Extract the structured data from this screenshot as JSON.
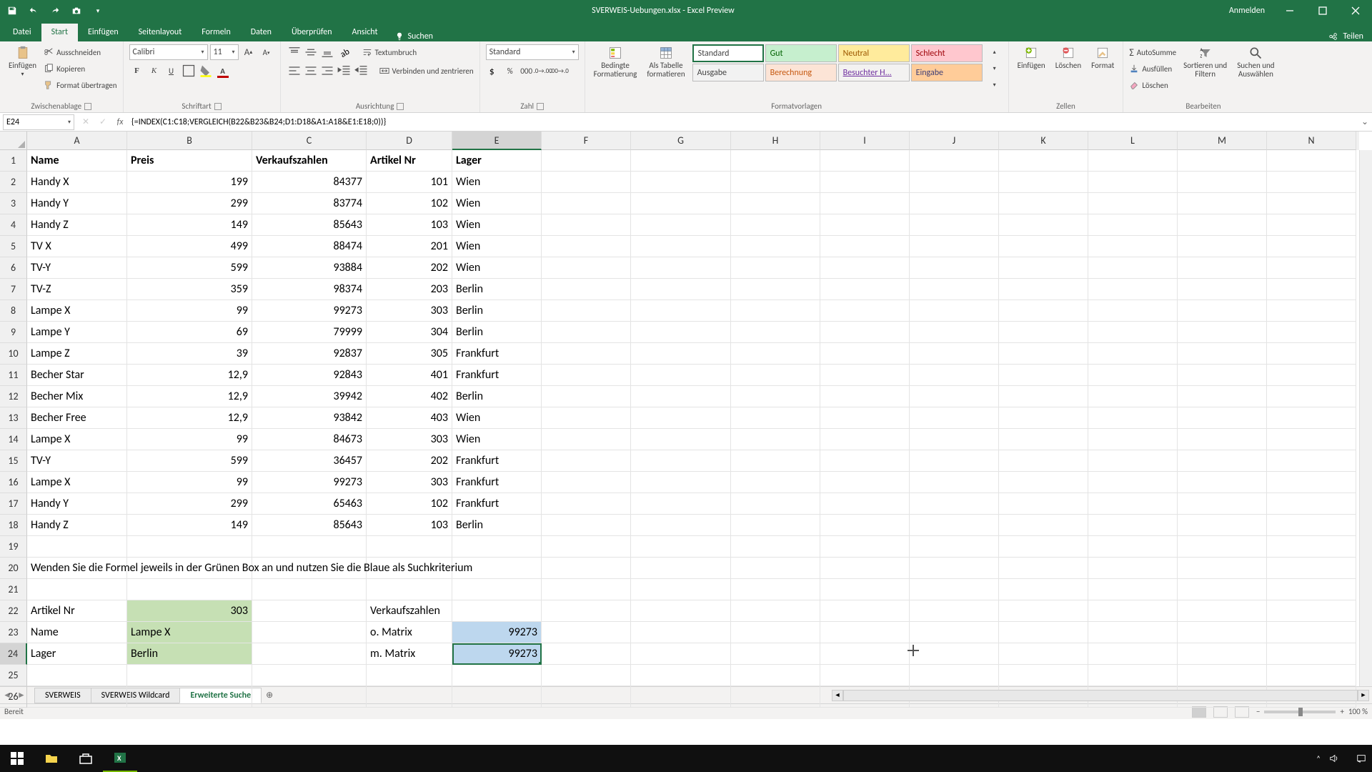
{
  "title": "SVERWEIS-Uebungen.xlsx - Excel Preview",
  "anmelden": "Anmelden",
  "tabs": {
    "datei": "Datei",
    "start": "Start",
    "einfuegen": "Einfügen",
    "seitenlayout": "Seitenlayout",
    "formeln": "Formeln",
    "daten": "Daten",
    "ueberpruefen": "Überprüfen",
    "ansicht": "Ansicht",
    "suchen": "Suchen",
    "teilen": "Teilen"
  },
  "ribbon": {
    "paste": "Einfügen",
    "cut": "Ausschneiden",
    "copy": "Kopieren",
    "formatpainter": "Format übertragen",
    "clipboard_label": "Zwischenablage",
    "font_name": "Calibri",
    "font_size": "11",
    "font_label": "Schriftart",
    "wrap": "Textumbruch",
    "merge": "Verbinden und zentrieren",
    "align_label": "Ausrichtung",
    "numfmt": "Standard",
    "num_label": "Zahl",
    "condfmt": "Bedingte\nFormatierung",
    "astable": "Als Tabelle\nformatieren",
    "style_standard": "Standard",
    "style_gut": "Gut",
    "style_neutral": "Neutral",
    "style_schlecht": "Schlecht",
    "style_ausgabe": "Ausgabe",
    "style_berechnung": "Berechnung",
    "style_besucht": "Besuchter H...",
    "style_eingabe": "Eingabe",
    "styles_label": "Formatvorlagen",
    "insert": "Einfügen",
    "delete": "Löschen",
    "format": "Format",
    "cells_label": "Zellen",
    "autosum": "AutoSumme",
    "fill": "Ausfüllen",
    "clear": "Löschen",
    "sort": "Sortieren und\nFiltern",
    "find": "Suchen und\nAuswählen",
    "edit_label": "Bearbeiten"
  },
  "namebox": "E24",
  "formula": "{=INDEX(C1:C18;VERGLEICH(B22&B23&B24;D1:D18&A1:A18&E1:E18;0))}",
  "cols": [
    "A",
    "B",
    "C",
    "D",
    "E",
    "F",
    "G",
    "H",
    "I",
    "J",
    "K",
    "L",
    "M",
    "N"
  ],
  "rows": [
    "1",
    "2",
    "3",
    "4",
    "5",
    "6",
    "7",
    "8",
    "9",
    "10",
    "11",
    "12",
    "13",
    "14",
    "15",
    "16",
    "17",
    "18",
    "19",
    "20",
    "21",
    "22",
    "23",
    "24",
    "25",
    "26"
  ],
  "grid": {
    "r1": {
      "A": "Name",
      "B": "Preis",
      "C": "Verkaufszahlen",
      "D": "Artikel Nr",
      "E": "Lager"
    },
    "r2": {
      "A": "Handy X",
      "B": "199",
      "C": "84377",
      "D": "101",
      "E": "Wien"
    },
    "r3": {
      "A": "Handy Y",
      "B": "299",
      "C": "83774",
      "D": "102",
      "E": "Wien"
    },
    "r4": {
      "A": "Handy Z",
      "B": "149",
      "C": "85643",
      "D": "103",
      "E": "Wien"
    },
    "r5": {
      "A": "TV X",
      "B": "499",
      "C": "88474",
      "D": "201",
      "E": "Wien"
    },
    "r6": {
      "A": "TV-Y",
      "B": "599",
      "C": "93884",
      "D": "202",
      "E": "Wien"
    },
    "r7": {
      "A": "TV-Z",
      "B": "359",
      "C": "98374",
      "D": "203",
      "E": "Berlin"
    },
    "r8": {
      "A": "Lampe X",
      "B": "99",
      "C": "99273",
      "D": "303",
      "E": "Berlin"
    },
    "r9": {
      "A": "Lampe Y",
      "B": "69",
      "C": "79999",
      "D": "304",
      "E": "Berlin"
    },
    "r10": {
      "A": "Lampe Z",
      "B": "39",
      "C": "92837",
      "D": "305",
      "E": "Frankfurt"
    },
    "r11": {
      "A": "Becher Star",
      "B": "12,9",
      "C": "92843",
      "D": "401",
      "E": "Frankfurt"
    },
    "r12": {
      "A": "Becher Mix",
      "B": "12,9",
      "C": "39942",
      "D": "402",
      "E": "Berlin"
    },
    "r13": {
      "A": "Becher Free",
      "B": "12,9",
      "C": "93842",
      "D": "403",
      "E": "Wien"
    },
    "r14": {
      "A": "Lampe X",
      "B": "99",
      "C": "84673",
      "D": "303",
      "E": "Wien"
    },
    "r15": {
      "A": "TV-Y",
      "B": "599",
      "C": "36457",
      "D": "202",
      "E": "Frankfurt"
    },
    "r16": {
      "A": "Lampe X",
      "B": "99",
      "C": "99273",
      "D": "303",
      "E": "Frankfurt"
    },
    "r17": {
      "A": "Handy Y",
      "B": "299",
      "C": "65463",
      "D": "102",
      "E": "Frankfurt"
    },
    "r18": {
      "A": "Handy Z",
      "B": "149",
      "C": "85643",
      "D": "103",
      "E": "Berlin"
    },
    "r20": {
      "A": "Wenden Sie die Formel jeweils in der Grünen Box an und nutzen Sie die Blaue als Suchkriterium"
    },
    "r22": {
      "A": "Artikel Nr",
      "B": "303",
      "D": "Verkaufszahlen"
    },
    "r23": {
      "A": "Name",
      "B": "Lampe X",
      "D": "o. Matrix",
      "E": "99273"
    },
    "r24": {
      "A": "Lager",
      "B": "Berlin",
      "D": "m. Matrix",
      "E": "99273"
    }
  },
  "sheets": {
    "s1": "SVERWEIS",
    "s2": "SVERWEIS Wildcard",
    "s3": "Erweiterte Suche"
  },
  "status": "Bereit",
  "zoom": "100 %",
  "time": "",
  "selected_col": "E",
  "selected_row": "24"
}
